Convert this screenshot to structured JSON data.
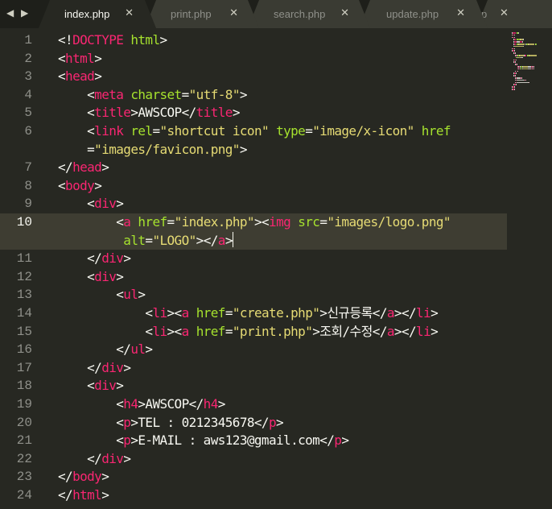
{
  "nav": {
    "back": "◀",
    "forward": "▶"
  },
  "tabs": [
    {
      "label": "index.php",
      "close": "✕",
      "active": true
    },
    {
      "label": "print.php",
      "close": "✕",
      "active": false
    },
    {
      "label": "search.php",
      "close": "✕",
      "active": false
    },
    {
      "label": "update.php",
      "close": "✕",
      "active": false
    },
    {
      "label": "p",
      "close": "✕",
      "active": false
    }
  ],
  "colors": {
    "tag": "#f92672",
    "attr": "#a6e22e",
    "string": "#e6db74",
    "text": "#f8f8f2",
    "background": "#272822",
    "line_highlight": "#3e3d32"
  },
  "editor": {
    "current_line": "10",
    "lines": [
      {
        "num": "1",
        "tokens": [
          [
            "t",
            "<!"
          ],
          [
            "g",
            "DOCTYPE"
          ],
          [
            "t",
            " "
          ],
          [
            "a",
            "html"
          ],
          [
            "t",
            ">"
          ]
        ]
      },
      {
        "num": "2",
        "tokens": [
          [
            "t",
            "<"
          ],
          [
            "g",
            "html"
          ],
          [
            "t",
            ">"
          ]
        ]
      },
      {
        "num": "3",
        "tokens": [
          [
            "t",
            "<"
          ],
          [
            "g",
            "head"
          ],
          [
            "t",
            ">"
          ]
        ]
      },
      {
        "num": "4",
        "tokens": [
          [
            "t",
            "    <"
          ],
          [
            "g",
            "meta"
          ],
          [
            "t",
            " "
          ],
          [
            "a",
            "charset"
          ],
          [
            "t",
            "="
          ],
          [
            "s",
            "\"utf-8\""
          ],
          [
            "t",
            ">"
          ]
        ]
      },
      {
        "num": "5",
        "tokens": [
          [
            "t",
            "    <"
          ],
          [
            "g",
            "title"
          ],
          [
            "t",
            ">AWSCOP</"
          ],
          [
            "g",
            "title"
          ],
          [
            "t",
            ">"
          ]
        ]
      },
      {
        "num": "6",
        "tokens": [
          [
            "t",
            "    <"
          ],
          [
            "g",
            "link"
          ],
          [
            "t",
            " "
          ],
          [
            "a",
            "rel"
          ],
          [
            "t",
            "="
          ],
          [
            "s",
            "\"shortcut icon\""
          ],
          [
            "t",
            " "
          ],
          [
            "a",
            "type"
          ],
          [
            "t",
            "="
          ],
          [
            "s",
            "\"image/x-icon\""
          ],
          [
            "t",
            " "
          ],
          [
            "a",
            "href"
          ]
        ]
      },
      {
        "num": "",
        "tokens": [
          [
            "t",
            "    ="
          ],
          [
            "s",
            "\"images/favicon.png\""
          ],
          [
            "t",
            ">"
          ]
        ]
      },
      {
        "num": "7",
        "tokens": [
          [
            "t",
            "</"
          ],
          [
            "g",
            "head"
          ],
          [
            "t",
            ">"
          ]
        ]
      },
      {
        "num": "8",
        "tokens": [
          [
            "t",
            "<"
          ],
          [
            "g",
            "body"
          ],
          [
            "t",
            ">"
          ]
        ]
      },
      {
        "num": "9",
        "tokens": [
          [
            "t",
            "    <"
          ],
          [
            "g",
            "div"
          ],
          [
            "t",
            ">"
          ]
        ]
      },
      {
        "num": "10",
        "tokens": [
          [
            "t",
            "        <"
          ],
          [
            "g",
            "a"
          ],
          [
            "t",
            " "
          ],
          [
            "a",
            "href"
          ],
          [
            "t",
            "="
          ],
          [
            "s",
            "\"index.php\""
          ],
          [
            "t",
            ">"
          ],
          [
            "t",
            "<"
          ],
          [
            "g",
            "img"
          ],
          [
            "t",
            " "
          ],
          [
            "a",
            "src"
          ],
          [
            "t",
            "="
          ],
          [
            "s",
            "\"images/logo.png\""
          ]
        ]
      },
      {
        "num": "",
        "tokens": [
          [
            "t",
            "         "
          ],
          [
            "a",
            "alt"
          ],
          [
            "t",
            "="
          ],
          [
            "s",
            "\"LOGO\""
          ],
          [
            "t",
            "></"
          ],
          [
            "g",
            "a"
          ],
          [
            "t",
            ">"
          ],
          [
            "c",
            ""
          ]
        ]
      },
      {
        "num": "11",
        "tokens": [
          [
            "t",
            "    </"
          ],
          [
            "g",
            "div"
          ],
          [
            "t",
            ">"
          ]
        ]
      },
      {
        "num": "12",
        "tokens": [
          [
            "t",
            "    <"
          ],
          [
            "g",
            "div"
          ],
          [
            "t",
            ">"
          ]
        ]
      },
      {
        "num": "13",
        "tokens": [
          [
            "t",
            "        <"
          ],
          [
            "g",
            "ul"
          ],
          [
            "t",
            ">"
          ]
        ]
      },
      {
        "num": "14",
        "tokens": [
          [
            "t",
            "            <"
          ],
          [
            "g",
            "li"
          ],
          [
            "t",
            "><"
          ],
          [
            "g",
            "a"
          ],
          [
            "t",
            " "
          ],
          [
            "a",
            "href"
          ],
          [
            "t",
            "="
          ],
          [
            "s",
            "\"create.php\""
          ],
          [
            "t",
            ">신규등록</"
          ],
          [
            "g",
            "a"
          ],
          [
            "t",
            "></"
          ],
          [
            "g",
            "li"
          ],
          [
            "t",
            ">"
          ]
        ]
      },
      {
        "num": "15",
        "tokens": [
          [
            "t",
            "            <"
          ],
          [
            "g",
            "li"
          ],
          [
            "t",
            "><"
          ],
          [
            "g",
            "a"
          ],
          [
            "t",
            " "
          ],
          [
            "a",
            "href"
          ],
          [
            "t",
            "="
          ],
          [
            "s",
            "\"print.php\""
          ],
          [
            "t",
            ">조회/수정</"
          ],
          [
            "g",
            "a"
          ],
          [
            "t",
            "></"
          ],
          [
            "g",
            "li"
          ],
          [
            "t",
            ">"
          ]
        ]
      },
      {
        "num": "16",
        "tokens": [
          [
            "t",
            "        </"
          ],
          [
            "g",
            "ul"
          ],
          [
            "t",
            ">"
          ]
        ]
      },
      {
        "num": "17",
        "tokens": [
          [
            "t",
            "    </"
          ],
          [
            "g",
            "div"
          ],
          [
            "t",
            ">"
          ]
        ]
      },
      {
        "num": "18",
        "tokens": [
          [
            "t",
            "    <"
          ],
          [
            "g",
            "div"
          ],
          [
            "t",
            ">"
          ]
        ]
      },
      {
        "num": "19",
        "tokens": [
          [
            "t",
            "        <"
          ],
          [
            "g",
            "h4"
          ],
          [
            "t",
            ">AWSCOP</"
          ],
          [
            "g",
            "h4"
          ],
          [
            "t",
            ">"
          ]
        ]
      },
      {
        "num": "20",
        "tokens": [
          [
            "t",
            "        <"
          ],
          [
            "g",
            "p"
          ],
          [
            "t",
            ">TEL : 0212345678</"
          ],
          [
            "g",
            "p"
          ],
          [
            "t",
            ">"
          ]
        ]
      },
      {
        "num": "21",
        "tokens": [
          [
            "t",
            "        <"
          ],
          [
            "g",
            "p"
          ],
          [
            "t",
            ">E-MAIL : aws123@gmail.com</"
          ],
          [
            "g",
            "p"
          ],
          [
            "t",
            ">"
          ]
        ]
      },
      {
        "num": "22",
        "tokens": [
          [
            "t",
            "    </"
          ],
          [
            "g",
            "div"
          ],
          [
            "t",
            ">"
          ]
        ]
      },
      {
        "num": "23",
        "tokens": [
          [
            "t",
            "</"
          ],
          [
            "g",
            "body"
          ],
          [
            "t",
            ">"
          ]
        ]
      },
      {
        "num": "24",
        "tokens": [
          [
            "t",
            "</"
          ],
          [
            "g",
            "html"
          ],
          [
            "t",
            ">"
          ]
        ]
      }
    ]
  }
}
